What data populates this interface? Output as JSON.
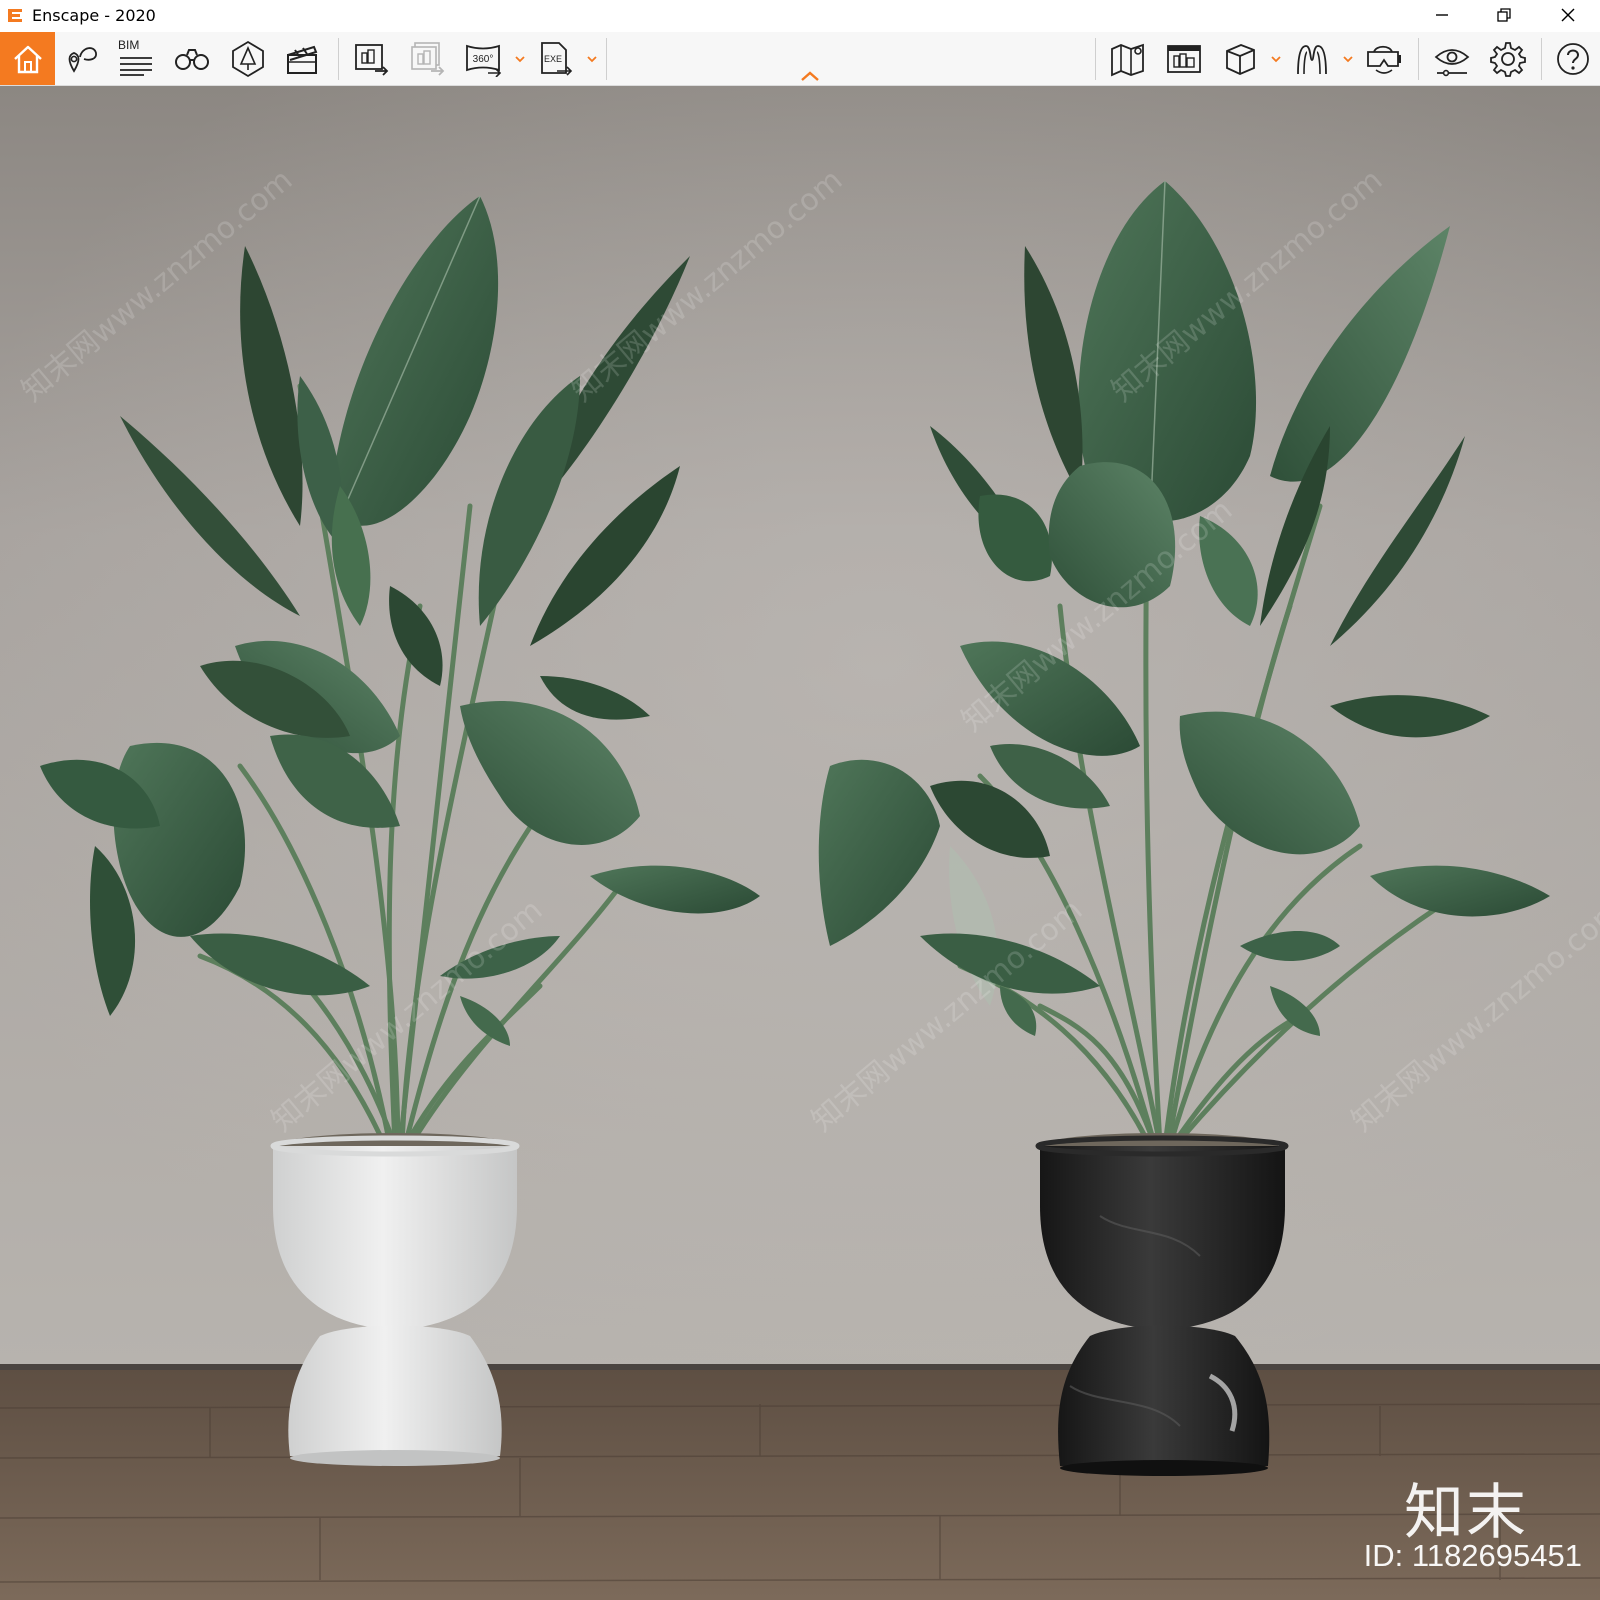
{
  "window": {
    "title": "Enscape - 2020",
    "accent_color": "#f47a20"
  },
  "toolbar": {
    "bim_label": "BIM",
    "buttons": [
      {
        "name": "home-icon",
        "tooltip": ""
      },
      {
        "name": "view-management-icon"
      },
      {
        "name": "bim-info-icon"
      },
      {
        "name": "fly-mode-binoculars-icon"
      },
      {
        "name": "asset-library-icon"
      },
      {
        "name": "video-editor-clapper-icon"
      },
      {
        "name": "render-image-icon"
      },
      {
        "name": "batch-render-icon"
      },
      {
        "name": "panorama-360-icon"
      },
      {
        "name": "export-exe-icon"
      },
      {
        "name": "minimap-icon"
      },
      {
        "name": "capture-screenshot-icon"
      },
      {
        "name": "cube-icon"
      },
      {
        "name": "walk-mode-icon"
      },
      {
        "name": "vr-headset-icon"
      },
      {
        "name": "visual-settings-eye-icon"
      },
      {
        "name": "settings-gear-icon"
      },
      {
        "name": "help-icon"
      }
    ],
    "pano_label": "360°",
    "exe_label": "EXE"
  },
  "viewport": {
    "brand_mark": "知末",
    "id_text": "ID: 1182695451",
    "watermark_text": "知末网www.znzmo.com",
    "wall_color": "#a6a19c",
    "floor_color": "#6f5d4e"
  }
}
